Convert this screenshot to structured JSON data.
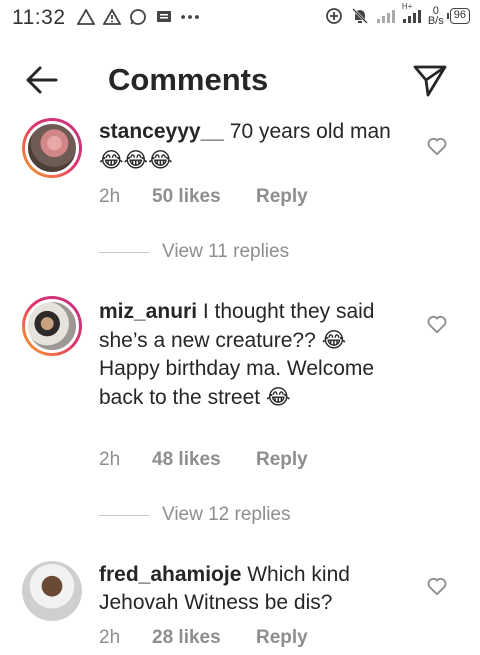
{
  "status_bar": {
    "time": "11:32",
    "speed_value": "0",
    "speed_unit": "B/s",
    "network": "H+",
    "battery": "96"
  },
  "header": {
    "title": "Comments"
  },
  "comments": [
    {
      "username": "stanceyyy__",
      "text": " 70 years old man ",
      "emojis": "😂😂😂",
      "time": "2h",
      "likes": "50 likes",
      "reply": "Reply",
      "view_replies": "View 11 replies"
    },
    {
      "username": "miz_anuri",
      "text_a": " I thought they said she’s a new creature?? ",
      "emoji_a": "😂",
      "text_b": "Happy birthday ma. Welcome back to the street ",
      "emoji_b": "😂",
      "time": "2h",
      "likes": "48 likes",
      "reply": "Reply",
      "view_replies": "View 12 replies"
    },
    {
      "username": "fred_ahamioje",
      "text": " Which kind Jehovah Witness be dis?",
      "time": "2h",
      "likes": "28 likes",
      "reply": "Reply"
    }
  ]
}
